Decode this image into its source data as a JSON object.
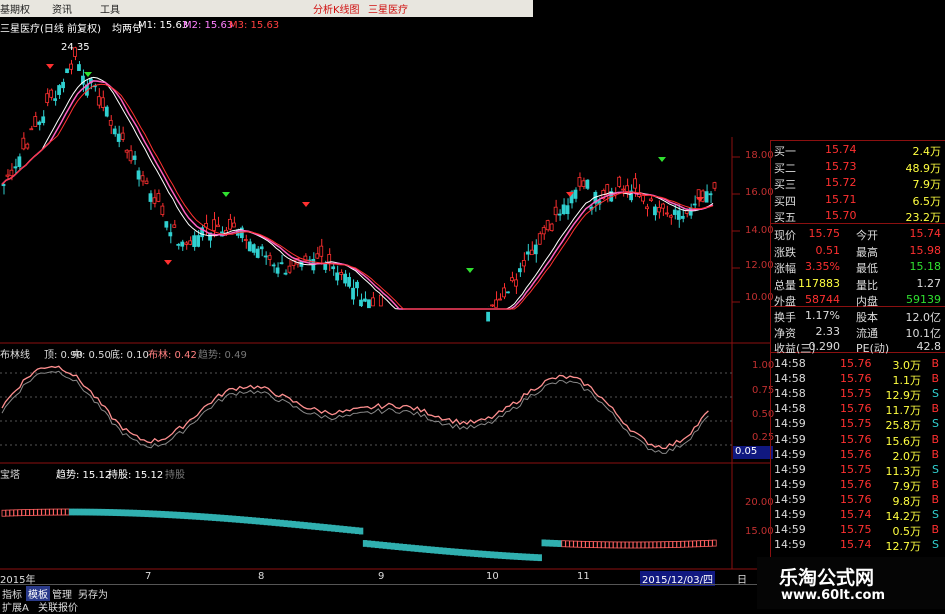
{
  "menu": {
    "items": [
      "资讯",
      "工具"
    ],
    "left_text": "基期权",
    "alert1": "分析K线图",
    "alert2": "三星医疗"
  },
  "main_chart": {
    "title": "三星医疗(日线 前复权)",
    "subtitle": "均两句",
    "m1": "M1: 15.63",
    "m2": "M2: 15.63",
    "m3": "M3: 15.63",
    "high_label": "24.35",
    "y_ticks": [
      "18.00",
      "16.00",
      "14.00",
      "12.00",
      "10.00"
    ]
  },
  "boll_panel": {
    "name": "布林线",
    "top": "顶: 0.90",
    "mid": "中: 0.50",
    "bottom": "底: 0.10",
    "value": "布林: 0.42",
    "trend": "趋势: 0.49",
    "y_ticks": [
      "1.00",
      "0.75",
      "0.50",
      "0.25"
    ],
    "cursor_value": "0.05"
  },
  "bao_panel": {
    "name": "宝塔",
    "trend": "趋势: 15.12",
    "hold": "持股: 15.12",
    "hold2": "持股",
    "y_ticks": [
      "20.00",
      "15.00"
    ]
  },
  "x_axis": {
    "labels": [
      "2015年",
      "7",
      "8",
      "9",
      "10",
      "11"
    ],
    "current_date": "2015/12/03/四",
    "right_tag": "日"
  },
  "quote": {
    "bids": [
      {
        "label": "买一",
        "price": "15.74",
        "vol": "2.4万"
      },
      {
        "label": "买二",
        "price": "15.73",
        "vol": "48.9万"
      },
      {
        "label": "买三",
        "price": "15.72",
        "vol": "7.9万"
      },
      {
        "label": "买四",
        "price": "15.71",
        "vol": "6.5万"
      },
      {
        "label": "买五",
        "price": "15.70",
        "vol": "23.2万"
      }
    ],
    "stats": [
      {
        "k1": "现价",
        "v1": "15.75",
        "k2": "今开",
        "v2": "15.74"
      },
      {
        "k1": "涨跌",
        "v1": "0.51",
        "k2": "最高",
        "v2": "15.98"
      },
      {
        "k1": "涨幅",
        "v1": "3.35%",
        "k2": "最低",
        "v2": "15.18"
      },
      {
        "k1": "总量",
        "v1": "117883",
        "k2": "量比",
        "v2": "1.27"
      },
      {
        "k1": "外盘",
        "v1": "58744",
        "k2": "内盘",
        "v2": "59139"
      }
    ],
    "fund": [
      {
        "k1": "换手",
        "v1": "1.17%",
        "k2": "股本",
        "v2": "12.0亿"
      },
      {
        "k1": "净资",
        "v1": "2.33",
        "k2": "流通",
        "v2": "10.1亿"
      },
      {
        "k1": "收益(三)",
        "v1": "0.290",
        "k2": "PE(动)",
        "v2": "42.8"
      }
    ],
    "ticks": [
      {
        "t": "14:58",
        "p": "15.76",
        "v": "3.0万",
        "s": "B"
      },
      {
        "t": "14:58",
        "p": "15.76",
        "v": "1.1万",
        "s": "B"
      },
      {
        "t": "14:58",
        "p": "15.75",
        "v": "12.9万",
        "s": "S"
      },
      {
        "t": "14:58",
        "p": "15.76",
        "v": "11.7万",
        "s": "B"
      },
      {
        "t": "14:59",
        "p": "15.75",
        "v": "25.8万",
        "s": "S"
      },
      {
        "t": "14:59",
        "p": "15.76",
        "v": "15.6万",
        "s": "B"
      },
      {
        "t": "14:59",
        "p": "15.76",
        "v": "2.0万",
        "s": "B"
      },
      {
        "t": "14:59",
        "p": "15.75",
        "v": "11.3万",
        "s": "S"
      },
      {
        "t": "14:59",
        "p": "15.76",
        "v": "7.9万",
        "s": "B"
      },
      {
        "t": "14:59",
        "p": "15.76",
        "v": "9.8万",
        "s": "B"
      },
      {
        "t": "14:59",
        "p": "15.74",
        "v": "14.2万",
        "s": "S"
      },
      {
        "t": "14:59",
        "p": "15.75",
        "v": "0.5万",
        "s": "B"
      },
      {
        "t": "14:59",
        "p": "15.74",
        "v": "12.7万",
        "s": "S"
      }
    ]
  },
  "bottom_tabs": [
    "指标",
    "模板",
    "管理",
    "另存为"
  ],
  "bottom_tabs2": [
    "扩展A",
    "关联报价"
  ],
  "logo": {
    "cn": "乐淘公式网",
    "url": "www.60lt.com"
  },
  "colors": {
    "up": "#ff3030",
    "down": "#30d0d0",
    "accent": "#ffff00",
    "grid": "#8b1010"
  }
}
